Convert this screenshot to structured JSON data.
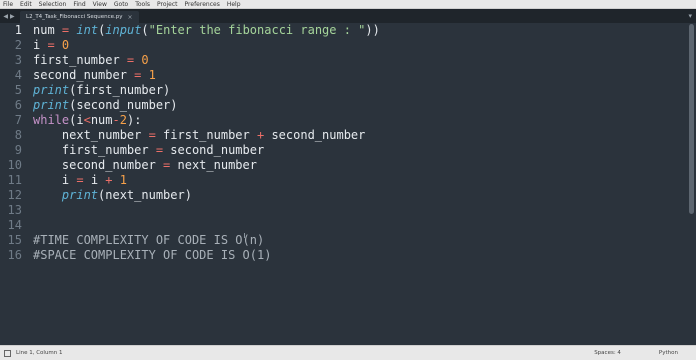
{
  "menu": [
    "File",
    "Edit",
    "Selection",
    "Find",
    "View",
    "Goto",
    "Tools",
    "Project",
    "Preferences",
    "Help"
  ],
  "tab": {
    "filename": "L2_T4_Task_Fibonacci Sequence.py",
    "close": "×"
  },
  "editor": {
    "line_numbers": [
      "1",
      "2",
      "3",
      "4",
      "5",
      "6",
      "7",
      "8",
      "9",
      "10",
      "11",
      "12",
      "13",
      "14",
      "15",
      "16"
    ],
    "lines": [
      [
        {
          "c": "v",
          "t": "num "
        },
        {
          "c": "op",
          "t": "="
        },
        {
          "c": "v",
          "t": " "
        },
        {
          "c": "fn",
          "t": "int"
        },
        {
          "c": "v",
          "t": "("
        },
        {
          "c": "fn",
          "t": "input"
        },
        {
          "c": "v",
          "t": "("
        },
        {
          "c": "str",
          "t": "\"Enter the fibonacci range : \""
        },
        {
          "c": "v",
          "t": "))"
        }
      ],
      [
        {
          "c": "v",
          "t": "i "
        },
        {
          "c": "op",
          "t": "="
        },
        {
          "c": "v",
          "t": " "
        },
        {
          "c": "num",
          "t": "0"
        }
      ],
      [
        {
          "c": "v",
          "t": "first_number "
        },
        {
          "c": "op",
          "t": "="
        },
        {
          "c": "v",
          "t": " "
        },
        {
          "c": "num",
          "t": "0"
        }
      ],
      [
        {
          "c": "v",
          "t": "second_number "
        },
        {
          "c": "op",
          "t": "="
        },
        {
          "c": "v",
          "t": " "
        },
        {
          "c": "num",
          "t": "1"
        }
      ],
      [
        {
          "c": "fn",
          "t": "print"
        },
        {
          "c": "v",
          "t": "(first_number)"
        }
      ],
      [
        {
          "c": "fn",
          "t": "print"
        },
        {
          "c": "v",
          "t": "(second_number)"
        }
      ],
      [
        {
          "c": "kw",
          "t": "while"
        },
        {
          "c": "v",
          "t": "(i"
        },
        {
          "c": "op",
          "t": "<"
        },
        {
          "c": "v",
          "t": "num"
        },
        {
          "c": "op",
          "t": "-"
        },
        {
          "c": "num",
          "t": "2"
        },
        {
          "c": "v",
          "t": "):"
        }
      ],
      [
        {
          "c": "v",
          "t": "    next_number "
        },
        {
          "c": "op",
          "t": "="
        },
        {
          "c": "v",
          "t": " first_number "
        },
        {
          "c": "op",
          "t": "+"
        },
        {
          "c": "v",
          "t": " second_number"
        }
      ],
      [
        {
          "c": "v",
          "t": "    first_number "
        },
        {
          "c": "op",
          "t": "="
        },
        {
          "c": "v",
          "t": " second_number"
        }
      ],
      [
        {
          "c": "v",
          "t": "    second_number "
        },
        {
          "c": "op",
          "t": "="
        },
        {
          "c": "v",
          "t": " next_number"
        }
      ],
      [
        {
          "c": "v",
          "t": "    i "
        },
        {
          "c": "op",
          "t": "="
        },
        {
          "c": "v",
          "t": " i "
        },
        {
          "c": "op",
          "t": "+"
        },
        {
          "c": "v",
          "t": " "
        },
        {
          "c": "num",
          "t": "1"
        }
      ],
      [
        {
          "c": "v",
          "t": "    "
        },
        {
          "c": "fn",
          "t": "print"
        },
        {
          "c": "v",
          "t": "(next_number)"
        }
      ],
      [],
      [],
      [
        {
          "c": "cm",
          "t": "#TIME COMPLEXITY OF CODE IS O(n)"
        }
      ],
      [
        {
          "c": "cm",
          "t": "#SPACE COMPLEXITY OF CODE IS O(1)"
        }
      ]
    ]
  },
  "status": {
    "position": "Line 1, Column 1",
    "spaces": "Spaces: 4",
    "syntax": "Python"
  },
  "colors": {
    "background": "#2b333c",
    "keyword": "#c592c8",
    "operator": "#ec6f68",
    "number": "#f7a14a",
    "function": "#5fb3d6",
    "string": "#a5d49a"
  }
}
